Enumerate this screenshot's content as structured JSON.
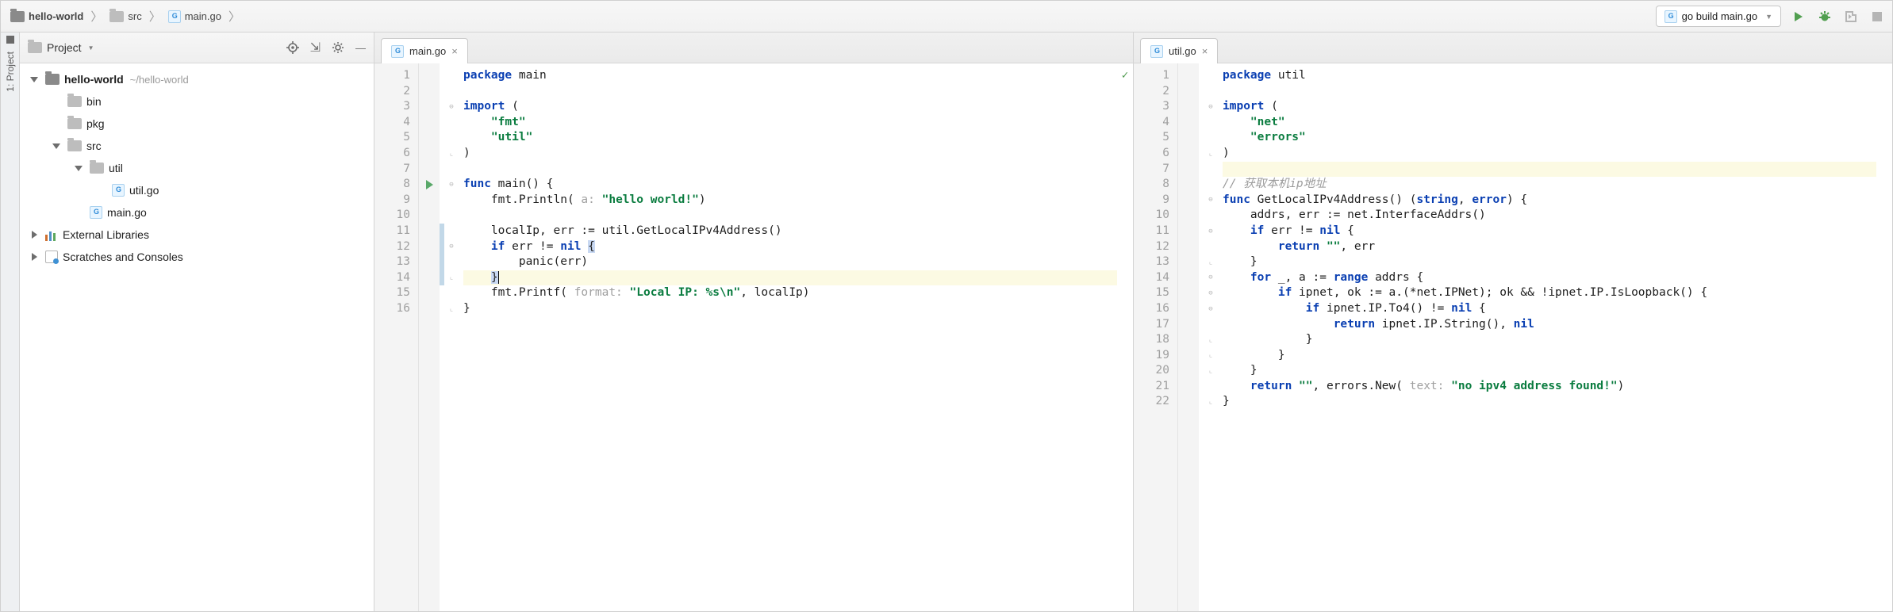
{
  "breadcrumb": {
    "items": [
      {
        "label": "hello-world",
        "icon": "folder"
      },
      {
        "label": "src",
        "icon": "folder"
      },
      {
        "label": "main.go",
        "icon": "gofile"
      }
    ]
  },
  "run_config": {
    "label": "go build main.go"
  },
  "sidebar": {
    "title": "Project",
    "tool_label": "1: Project",
    "tree": [
      {
        "depth": 0,
        "arrow": "open",
        "icon": "folder-dark",
        "label": "hello-world",
        "hint": "~/hello-world",
        "bold": true
      },
      {
        "depth": 1,
        "arrow": "none",
        "icon": "folder",
        "label": "bin"
      },
      {
        "depth": 1,
        "arrow": "none",
        "icon": "folder",
        "label": "pkg"
      },
      {
        "depth": 1,
        "arrow": "open",
        "icon": "folder",
        "label": "src"
      },
      {
        "depth": 2,
        "arrow": "open",
        "icon": "folder",
        "label": "util"
      },
      {
        "depth": 3,
        "arrow": "none",
        "icon": "gofile",
        "label": "util.go"
      },
      {
        "depth": 2,
        "arrow": "none",
        "icon": "gofile",
        "label": "main.go"
      },
      {
        "depth": 0,
        "arrow": "closed",
        "icon": "lib",
        "label": "External Libraries"
      },
      {
        "depth": 0,
        "arrow": "closed",
        "icon": "scratch",
        "label": "Scratches and Consoles"
      }
    ]
  },
  "editors": [
    {
      "tab": "main.go",
      "lines": [
        1,
        2,
        3,
        4,
        5,
        6,
        7,
        8,
        9,
        10,
        11,
        12,
        13,
        14,
        15,
        16
      ],
      "highlight_line": 14,
      "run_triangle_line": 8,
      "change_bar_lines": [
        11,
        12,
        13,
        14
      ],
      "has_check": true,
      "tokens": [
        [
          {
            "t": "package ",
            "c": "kw"
          },
          {
            "t": "main",
            "c": "pkg"
          }
        ],
        [],
        [
          {
            "t": "import ",
            "c": "kw"
          },
          {
            "t": "(",
            "c": ""
          }
        ],
        [
          {
            "t": "    ",
            "c": ""
          },
          {
            "t": "\"fmt\"",
            "c": "str"
          }
        ],
        [
          {
            "t": "    ",
            "c": ""
          },
          {
            "t": "\"util\"",
            "c": "str"
          }
        ],
        [
          {
            "t": ")",
            "c": ""
          }
        ],
        [],
        [
          {
            "t": "func ",
            "c": "kw"
          },
          {
            "t": "main() {",
            "c": ""
          }
        ],
        [
          {
            "t": "    fmt.Println(",
            "c": ""
          },
          {
            "t": " a: ",
            "c": "hint"
          },
          {
            "t": "\"hello world!\"",
            "c": "str"
          },
          {
            "t": ")",
            "c": ""
          }
        ],
        [],
        [
          {
            "t": "    localIp, err := util.GetLocalIPv4Address()",
            "c": ""
          }
        ],
        [
          {
            "t": "    ",
            "c": ""
          },
          {
            "t": "if ",
            "c": "kw"
          },
          {
            "t": "err != ",
            "c": ""
          },
          {
            "t": "nil ",
            "c": "kw"
          },
          {
            "t": "{",
            "c": "sel"
          }
        ],
        [
          {
            "t": "        panic(err)",
            "c": ""
          }
        ],
        [
          {
            "t": "    ",
            "c": ""
          },
          {
            "t": "}",
            "c": "sel"
          },
          {
            "t": "",
            "c": "caret"
          }
        ],
        [
          {
            "t": "    fmt.Printf(",
            "c": ""
          },
          {
            "t": " format: ",
            "c": "hint"
          },
          {
            "t": "\"Local IP: %s\\n\"",
            "c": "str"
          },
          {
            "t": ", localIp)",
            "c": ""
          }
        ],
        [
          {
            "t": "}",
            "c": ""
          }
        ]
      ]
    },
    {
      "tab": "util.go",
      "lines": [
        1,
        2,
        3,
        4,
        5,
        6,
        7,
        8,
        9,
        10,
        11,
        12,
        13,
        14,
        15,
        16,
        17,
        18,
        19,
        20,
        21,
        22
      ],
      "highlight_line": 7,
      "run_triangle_line": 0,
      "change_bar_lines": [],
      "has_check": false,
      "tokens": [
        [
          {
            "t": "package ",
            "c": "kw"
          },
          {
            "t": "util",
            "c": "pkg"
          }
        ],
        [],
        [
          {
            "t": "import ",
            "c": "kw"
          },
          {
            "t": "(",
            "c": ""
          }
        ],
        [
          {
            "t": "    ",
            "c": ""
          },
          {
            "t": "\"net\"",
            "c": "str"
          }
        ],
        [
          {
            "t": "    ",
            "c": ""
          },
          {
            "t": "\"errors\"",
            "c": "str"
          }
        ],
        [
          {
            "t": ")",
            "c": ""
          }
        ],
        [],
        [
          {
            "t": "// 获取本机ip地址",
            "c": "comment"
          }
        ],
        [
          {
            "t": "func ",
            "c": "kw"
          },
          {
            "t": "GetLocalIPv4Address() (",
            "c": ""
          },
          {
            "t": "string",
            "c": "kw"
          },
          {
            "t": ", ",
            "c": ""
          },
          {
            "t": "error",
            "c": "kw"
          },
          {
            "t": ") {",
            "c": ""
          }
        ],
        [
          {
            "t": "    addrs, err := net.InterfaceAddrs()",
            "c": ""
          }
        ],
        [
          {
            "t": "    ",
            "c": ""
          },
          {
            "t": "if ",
            "c": "kw"
          },
          {
            "t": "err != ",
            "c": ""
          },
          {
            "t": "nil",
            "c": "kw"
          },
          {
            "t": " {",
            "c": ""
          }
        ],
        [
          {
            "t": "        ",
            "c": ""
          },
          {
            "t": "return ",
            "c": "kw"
          },
          {
            "t": "\"\"",
            "c": "str"
          },
          {
            "t": ", err",
            "c": ""
          }
        ],
        [
          {
            "t": "    }",
            "c": ""
          }
        ],
        [
          {
            "t": "    ",
            "c": ""
          },
          {
            "t": "for ",
            "c": "kw"
          },
          {
            "t": "_, a := ",
            "c": ""
          },
          {
            "t": "range ",
            "c": "kw"
          },
          {
            "t": "addrs {",
            "c": ""
          }
        ],
        [
          {
            "t": "        ",
            "c": ""
          },
          {
            "t": "if ",
            "c": "kw"
          },
          {
            "t": "ipnet, ok := a.(*net.IPNet); ok && !ipnet.IP.IsLoopback() {",
            "c": ""
          }
        ],
        [
          {
            "t": "            ",
            "c": ""
          },
          {
            "t": "if ",
            "c": "kw"
          },
          {
            "t": "ipnet.IP.To4() != ",
            "c": ""
          },
          {
            "t": "nil",
            "c": "kw"
          },
          {
            "t": " {",
            "c": ""
          }
        ],
        [
          {
            "t": "                ",
            "c": ""
          },
          {
            "t": "return ",
            "c": "kw"
          },
          {
            "t": "ipnet.IP.String(), ",
            "c": ""
          },
          {
            "t": "nil",
            "c": "kw"
          }
        ],
        [
          {
            "t": "            }",
            "c": ""
          }
        ],
        [
          {
            "t": "        }",
            "c": ""
          }
        ],
        [
          {
            "t": "    }",
            "c": ""
          }
        ],
        [
          {
            "t": "    ",
            "c": ""
          },
          {
            "t": "return ",
            "c": "kw"
          },
          {
            "t": "\"\"",
            "c": "str"
          },
          {
            "t": ", errors.New(",
            "c": ""
          },
          {
            "t": " text: ",
            "c": "hint"
          },
          {
            "t": "\"no ipv4 address found!\"",
            "c": "str"
          },
          {
            "t": ")",
            "c": ""
          }
        ],
        [
          {
            "t": "}",
            "c": ""
          }
        ]
      ]
    }
  ]
}
